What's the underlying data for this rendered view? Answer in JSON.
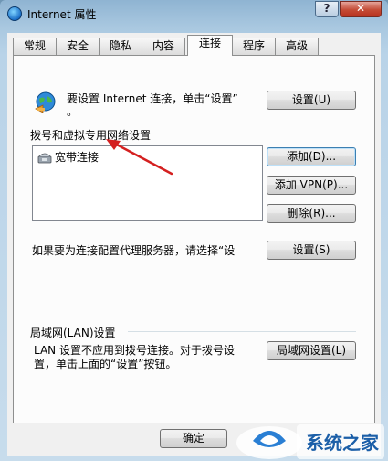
{
  "window": {
    "title": "Internet 属性",
    "help_glyph": "?",
    "close_glyph": "✕"
  },
  "tabs": [
    {
      "label": "常规"
    },
    {
      "label": "安全"
    },
    {
      "label": "隐私"
    },
    {
      "label": "内容"
    },
    {
      "label": "连接"
    },
    {
      "label": "程序"
    },
    {
      "label": "高级"
    }
  ],
  "setup": {
    "text_line1": "要设置 Internet 连接，单击“设置”",
    "text_line2": "。",
    "button": "设置(U)"
  },
  "dialup": {
    "heading": "拨号和虚拟专用网络设置",
    "items": [
      {
        "label": "宽带连接"
      }
    ],
    "add_button": "添加(D)...",
    "add_vpn_button": "添加 VPN(P)...",
    "delete_button": "删除(R)...",
    "proxy_text_line1": "如果要为连接配置代理服务器，请选择“设",
    "settings_button": "设置(S)"
  },
  "lan": {
    "heading": "局域网(LAN)设置",
    "text_line1": "LAN 设置不应用到拨号连接。对于拨号设",
    "text_line2": "置，单击上面的“设置”按钮。",
    "button": "局域网设置(L)"
  },
  "footer": {
    "ok_button": "确定"
  },
  "watermark": {
    "text": "系统之家"
  },
  "colors": {
    "annotation_arrow": "#d42020",
    "focus_border": "#3c7fb1"
  }
}
